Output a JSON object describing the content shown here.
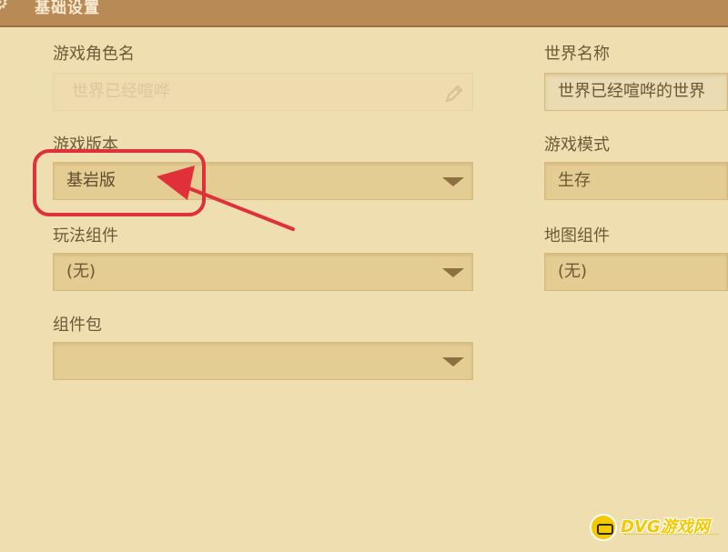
{
  "titlebar": {
    "title": "基础设置",
    "icon": "gear-icon"
  },
  "fields": {
    "character_name": {
      "label": "游戏角色名",
      "value": "世界已经喧哗"
    },
    "world_name": {
      "label": "世界名称",
      "value": "世界已经喧哗的世界"
    },
    "game_version": {
      "label": "游戏版本",
      "value": "基岩版"
    },
    "game_mode": {
      "label": "游戏模式",
      "value": "生存"
    },
    "gameplay_components": {
      "label": "玩法组件",
      "value": "(无)"
    },
    "map_components": {
      "label": "地图组件",
      "value": "(无)"
    },
    "component_pack": {
      "label": "组件包",
      "value": ""
    }
  },
  "annotation": {
    "color": "#e0303a"
  },
  "watermark": {
    "text": "DVG游戏网"
  },
  "colors": {
    "background": "#efdfb0",
    "titlebar": "#b88a55",
    "field": "#e4cd93",
    "accent": "#8e6f40"
  }
}
